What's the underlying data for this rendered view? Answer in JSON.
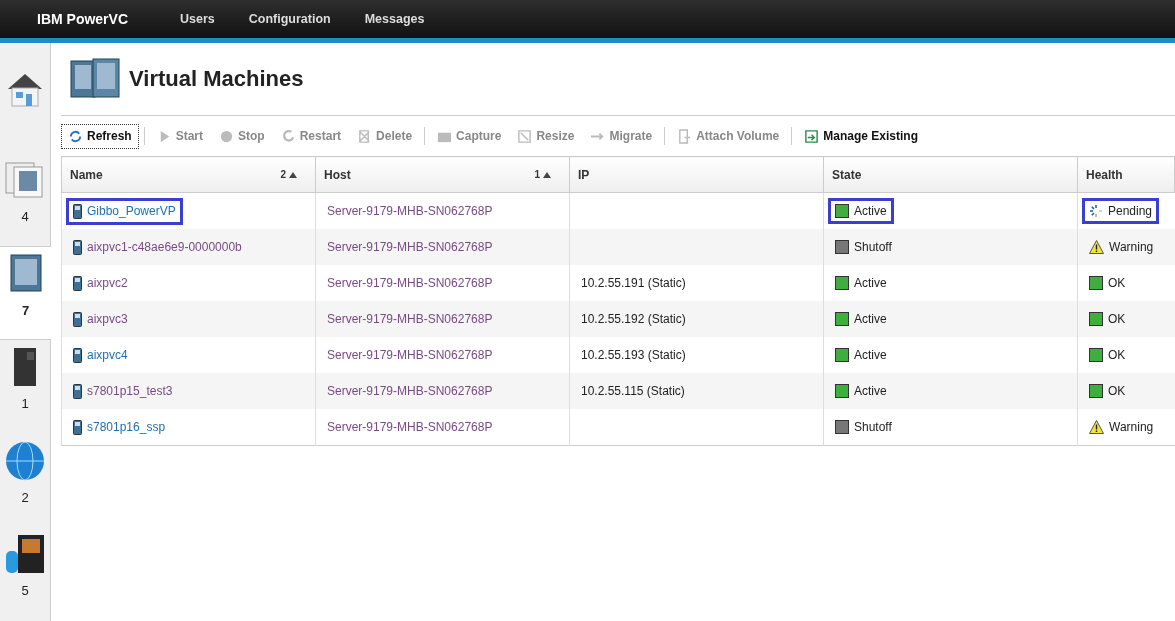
{
  "app": {
    "brand": "IBM PowerVC",
    "nav": [
      "Users",
      "Configuration",
      "Messages"
    ]
  },
  "sidebar": [
    {
      "kind": "home",
      "selected": false
    },
    {
      "kind": "images",
      "count": "4",
      "selected": false
    },
    {
      "kind": "vms",
      "count": "7",
      "selected": true
    },
    {
      "kind": "hosts",
      "count": "1",
      "selected": false
    },
    {
      "kind": "network",
      "count": "2",
      "selected": false
    },
    {
      "kind": "storage",
      "count": "5",
      "selected": false
    }
  ],
  "page": {
    "title": "Virtual Machines"
  },
  "toolbar": [
    {
      "kind": "refresh",
      "label": "Refresh",
      "disabled": false,
      "separator_after": true
    },
    {
      "kind": "start",
      "label": "Start",
      "disabled": true,
      "separator_after": false
    },
    {
      "kind": "stop",
      "label": "Stop",
      "disabled": true,
      "separator_after": false
    },
    {
      "kind": "restart",
      "label": "Restart",
      "disabled": true,
      "separator_after": false
    },
    {
      "kind": "delete",
      "label": "Delete",
      "disabled": true,
      "separator_after": true
    },
    {
      "kind": "capture",
      "label": "Capture",
      "disabled": true,
      "separator_after": false
    },
    {
      "kind": "resize",
      "label": "Resize",
      "disabled": true,
      "separator_after": false
    },
    {
      "kind": "migrate",
      "label": "Migrate",
      "disabled": true,
      "separator_after": true
    },
    {
      "kind": "attach",
      "label": "Attach Volume",
      "disabled": true,
      "separator_after": true
    },
    {
      "kind": "manage",
      "label": "Manage Existing",
      "disabled": false,
      "separator_after": false
    }
  ],
  "table": {
    "columns": [
      {
        "label": "Name",
        "sort_order": "2"
      },
      {
        "label": "Host",
        "sort_order": "1"
      },
      {
        "label": "IP"
      },
      {
        "label": "State"
      },
      {
        "label": "Health"
      }
    ],
    "rows": [
      {
        "name": "Gibbo_PowerVP",
        "visited": false,
        "host": "Server-9179-MHB-SN062768P",
        "state": {
          "kind": "active",
          "label": "Active"
        },
        "health": {
          "kind": "pending",
          "label": "Pending"
        },
        "highlighted": true
      },
      {
        "name": "aixpvc1-c48ae6e9-0000000b",
        "visited": true,
        "host": "Server-9179-MHB-SN062768P",
        "state": {
          "kind": "shutoff",
          "label": "Shutoff"
        },
        "health": {
          "kind": "warning",
          "label": "Warning"
        },
        "highlighted": false
      },
      {
        "name": "aixpvc2",
        "visited": true,
        "host": "Server-9179-MHB-SN062768P",
        "ip": "10.2.55.191 (Static)",
        "state": {
          "kind": "active",
          "label": "Active"
        },
        "health": {
          "kind": "ok",
          "label": "OK"
        },
        "highlighted": false
      },
      {
        "name": "aixpvc3",
        "visited": true,
        "host": "Server-9179-MHB-SN062768P",
        "ip": "10.2.55.192 (Static)",
        "state": {
          "kind": "active",
          "label": "Active"
        },
        "health": {
          "kind": "ok",
          "label": "OK"
        },
        "highlighted": false
      },
      {
        "name": "aixpvc4",
        "visited": false,
        "host": "Server-9179-MHB-SN062768P",
        "ip": "10.2.55.193 (Static)",
        "state": {
          "kind": "active",
          "label": "Active"
        },
        "health": {
          "kind": "ok",
          "label": "OK"
        },
        "highlighted": false
      },
      {
        "name": "s7801p15_test3",
        "visited": true,
        "host": "Server-9179-MHB-SN062768P",
        "ip": "10.2.55.115 (Static)",
        "state": {
          "kind": "active",
          "label": "Active"
        },
        "health": {
          "kind": "ok",
          "label": "OK"
        },
        "highlighted": false
      },
      {
        "name": "s7801p16_ssp",
        "visited": false,
        "host": "Server-9179-MHB-SN062768P",
        "state": {
          "kind": "shutoff",
          "label": "Shutoff"
        },
        "health": {
          "kind": "warning",
          "label": "Warning"
        },
        "highlighted": false
      }
    ]
  }
}
